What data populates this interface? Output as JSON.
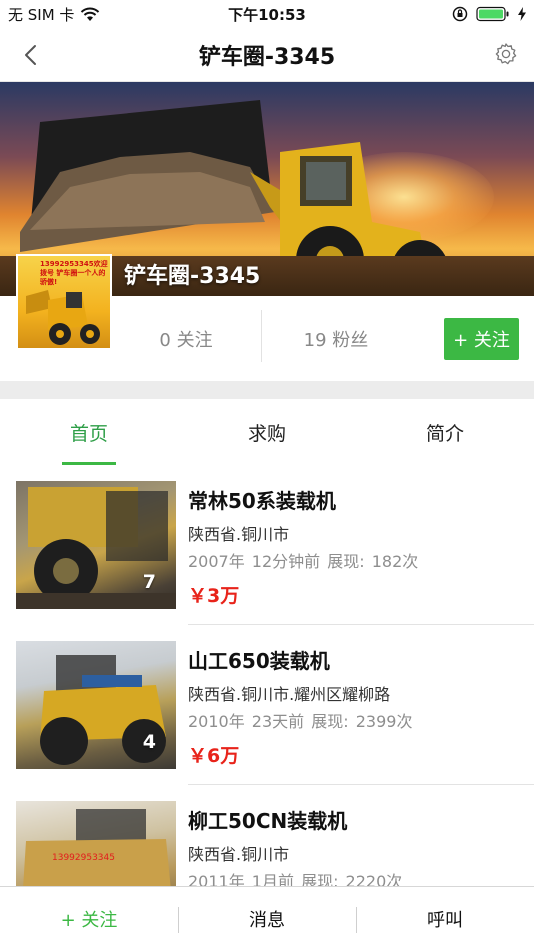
{
  "status": {
    "carrier": "无 SIM 卡",
    "time": "下午10:53"
  },
  "navbar": {
    "title": "铲车圈-3345"
  },
  "profile": {
    "name": "铲车圈-3345",
    "avatar_caption": "13992953345欢迎拨号 铲车圈一个人的骄傲!",
    "follows": "0 关注",
    "fans": "19 粉丝",
    "follow_button": "+ 关注"
  },
  "tabs": [
    {
      "label": "首页",
      "active": true
    },
    {
      "label": "求购",
      "active": false
    },
    {
      "label": "简介",
      "active": false
    }
  ],
  "listings": [
    {
      "title": "常林50系装载机",
      "location": "陕西省.铜川市",
      "meta": "2007年  12分钟前  展现: 182次",
      "price": "￥3万",
      "photo_count": "7"
    },
    {
      "title": "山工650装载机",
      "location": "陕西省.铜川市.耀州区耀柳路",
      "meta": "2010年  23天前  展现: 2399次",
      "price": "￥6万",
      "photo_count": "4"
    },
    {
      "title": "柳工50CN装载机",
      "location": "陕西省.铜川市",
      "meta": "2011年  1月前  展现: 2220次",
      "price": "",
      "photo_count": "",
      "watermark": "13992953345"
    }
  ],
  "bottombar": {
    "follow": "+ 关注",
    "message": "消息",
    "call": "呼叫"
  },
  "colors": {
    "accent_green": "#3cb844",
    "price_red": "#e8231a"
  }
}
